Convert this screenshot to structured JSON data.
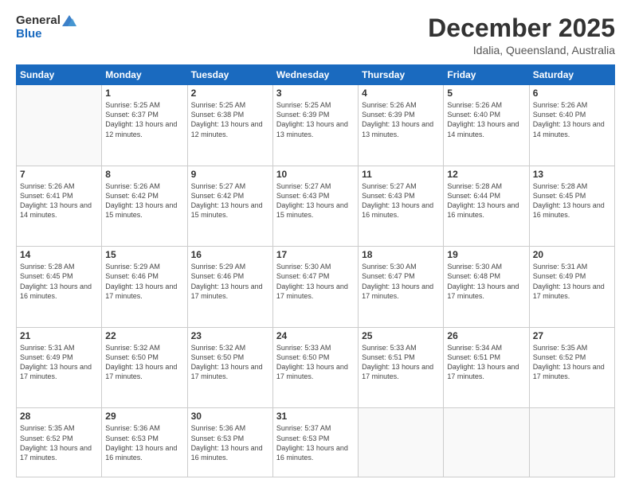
{
  "logo": {
    "line1": "General",
    "line2": "Blue",
    "icon_color": "#1a6abf"
  },
  "header": {
    "title": "December 2025",
    "subtitle": "Idalia, Queensland, Australia"
  },
  "weekdays": [
    "Sunday",
    "Monday",
    "Tuesday",
    "Wednesday",
    "Thursday",
    "Friday",
    "Saturday"
  ],
  "weeks": [
    [
      {
        "day": "",
        "info": ""
      },
      {
        "day": "1",
        "info": "Sunrise: 5:25 AM\nSunset: 6:37 PM\nDaylight: 13 hours\nand 12 minutes."
      },
      {
        "day": "2",
        "info": "Sunrise: 5:25 AM\nSunset: 6:38 PM\nDaylight: 13 hours\nand 12 minutes."
      },
      {
        "day": "3",
        "info": "Sunrise: 5:25 AM\nSunset: 6:39 PM\nDaylight: 13 hours\nand 13 minutes."
      },
      {
        "day": "4",
        "info": "Sunrise: 5:26 AM\nSunset: 6:39 PM\nDaylight: 13 hours\nand 13 minutes."
      },
      {
        "day": "5",
        "info": "Sunrise: 5:26 AM\nSunset: 6:40 PM\nDaylight: 13 hours\nand 14 minutes."
      },
      {
        "day": "6",
        "info": "Sunrise: 5:26 AM\nSunset: 6:40 PM\nDaylight: 13 hours\nand 14 minutes."
      }
    ],
    [
      {
        "day": "7",
        "info": "Sunrise: 5:26 AM\nSunset: 6:41 PM\nDaylight: 13 hours\nand 14 minutes."
      },
      {
        "day": "8",
        "info": "Sunrise: 5:26 AM\nSunset: 6:42 PM\nDaylight: 13 hours\nand 15 minutes."
      },
      {
        "day": "9",
        "info": "Sunrise: 5:27 AM\nSunset: 6:42 PM\nDaylight: 13 hours\nand 15 minutes."
      },
      {
        "day": "10",
        "info": "Sunrise: 5:27 AM\nSunset: 6:43 PM\nDaylight: 13 hours\nand 15 minutes."
      },
      {
        "day": "11",
        "info": "Sunrise: 5:27 AM\nSunset: 6:43 PM\nDaylight: 13 hours\nand 16 minutes."
      },
      {
        "day": "12",
        "info": "Sunrise: 5:28 AM\nSunset: 6:44 PM\nDaylight: 13 hours\nand 16 minutes."
      },
      {
        "day": "13",
        "info": "Sunrise: 5:28 AM\nSunset: 6:45 PM\nDaylight: 13 hours\nand 16 minutes."
      }
    ],
    [
      {
        "day": "14",
        "info": "Sunrise: 5:28 AM\nSunset: 6:45 PM\nDaylight: 13 hours\nand 16 minutes."
      },
      {
        "day": "15",
        "info": "Sunrise: 5:29 AM\nSunset: 6:46 PM\nDaylight: 13 hours\nand 17 minutes."
      },
      {
        "day": "16",
        "info": "Sunrise: 5:29 AM\nSunset: 6:46 PM\nDaylight: 13 hours\nand 17 minutes."
      },
      {
        "day": "17",
        "info": "Sunrise: 5:30 AM\nSunset: 6:47 PM\nDaylight: 13 hours\nand 17 minutes."
      },
      {
        "day": "18",
        "info": "Sunrise: 5:30 AM\nSunset: 6:47 PM\nDaylight: 13 hours\nand 17 minutes."
      },
      {
        "day": "19",
        "info": "Sunrise: 5:30 AM\nSunset: 6:48 PM\nDaylight: 13 hours\nand 17 minutes."
      },
      {
        "day": "20",
        "info": "Sunrise: 5:31 AM\nSunset: 6:49 PM\nDaylight: 13 hours\nand 17 minutes."
      }
    ],
    [
      {
        "day": "21",
        "info": "Sunrise: 5:31 AM\nSunset: 6:49 PM\nDaylight: 13 hours\nand 17 minutes."
      },
      {
        "day": "22",
        "info": "Sunrise: 5:32 AM\nSunset: 6:50 PM\nDaylight: 13 hours\nand 17 minutes."
      },
      {
        "day": "23",
        "info": "Sunrise: 5:32 AM\nSunset: 6:50 PM\nDaylight: 13 hours\nand 17 minutes."
      },
      {
        "day": "24",
        "info": "Sunrise: 5:33 AM\nSunset: 6:50 PM\nDaylight: 13 hours\nand 17 minutes."
      },
      {
        "day": "25",
        "info": "Sunrise: 5:33 AM\nSunset: 6:51 PM\nDaylight: 13 hours\nand 17 minutes."
      },
      {
        "day": "26",
        "info": "Sunrise: 5:34 AM\nSunset: 6:51 PM\nDaylight: 13 hours\nand 17 minutes."
      },
      {
        "day": "27",
        "info": "Sunrise: 5:35 AM\nSunset: 6:52 PM\nDaylight: 13 hours\nand 17 minutes."
      }
    ],
    [
      {
        "day": "28",
        "info": "Sunrise: 5:35 AM\nSunset: 6:52 PM\nDaylight: 13 hours\nand 17 minutes."
      },
      {
        "day": "29",
        "info": "Sunrise: 5:36 AM\nSunset: 6:53 PM\nDaylight: 13 hours\nand 16 minutes."
      },
      {
        "day": "30",
        "info": "Sunrise: 5:36 AM\nSunset: 6:53 PM\nDaylight: 13 hours\nand 16 minutes."
      },
      {
        "day": "31",
        "info": "Sunrise: 5:37 AM\nSunset: 6:53 PM\nDaylight: 13 hours\nand 16 minutes."
      },
      {
        "day": "",
        "info": ""
      },
      {
        "day": "",
        "info": ""
      },
      {
        "day": "",
        "info": ""
      }
    ]
  ]
}
